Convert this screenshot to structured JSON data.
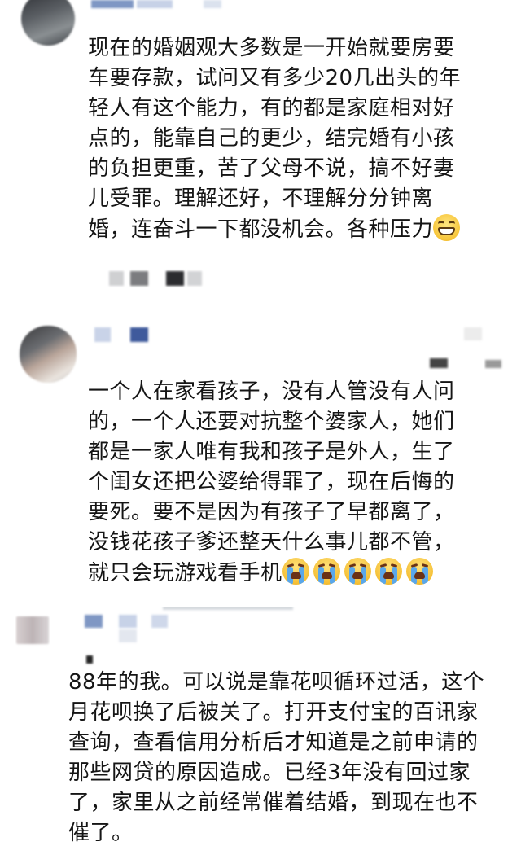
{
  "comments": [
    {
      "text": "现在的婚姻观大多数是一开始就要房要\n车要存款，试问又有多少20几出头的年\n轻人有这个能力，有的都是家庭相对好\n点的，能靠自己的更少，结完婚有小孩\n的负担更重，苦了父母不说，搞不好妻\n儿受罪。理解还好，不理解分分钟离\n婚，连奋斗一下都没机会。各种压力",
      "emojis": [
        "grin-emoji"
      ]
    },
    {
      "text": "一个人在家看孩子，没有人管没有人问\n的，一个人还要对抗整个婆家人，她们\n都是一家人唯有我和孩子是外人，生了\n个闺女还把公婆给得罪了，现在后悔的\n要死。要不是因为有孩子了早都离了，\n没钱花孩子爹还整天什么事儿都不管，\n就只会玩游戏看手机",
      "emojis": [
        "crying-emoji",
        "crying-emoji",
        "crying-emoji",
        "crying-emoji",
        "crying-emoji"
      ]
    },
    {
      "text": "88年的我。可以说是靠花呗循环过活，这个\n月花呗换了后被关了。打开支付宝的百讯家\n查询，查看信用分析后才知道是之前申请的\n那些网贷的原因造成。已经3年没有回过家\n了，家里从之前经常催着结婚，到现在也不\n催了。",
      "emojis": []
    }
  ],
  "colors": {
    "background": "#ffffff",
    "text": "#151515",
    "mosaic_blue": "#7f97c4",
    "mosaic_blue_dark": "#3f5a9c"
  }
}
